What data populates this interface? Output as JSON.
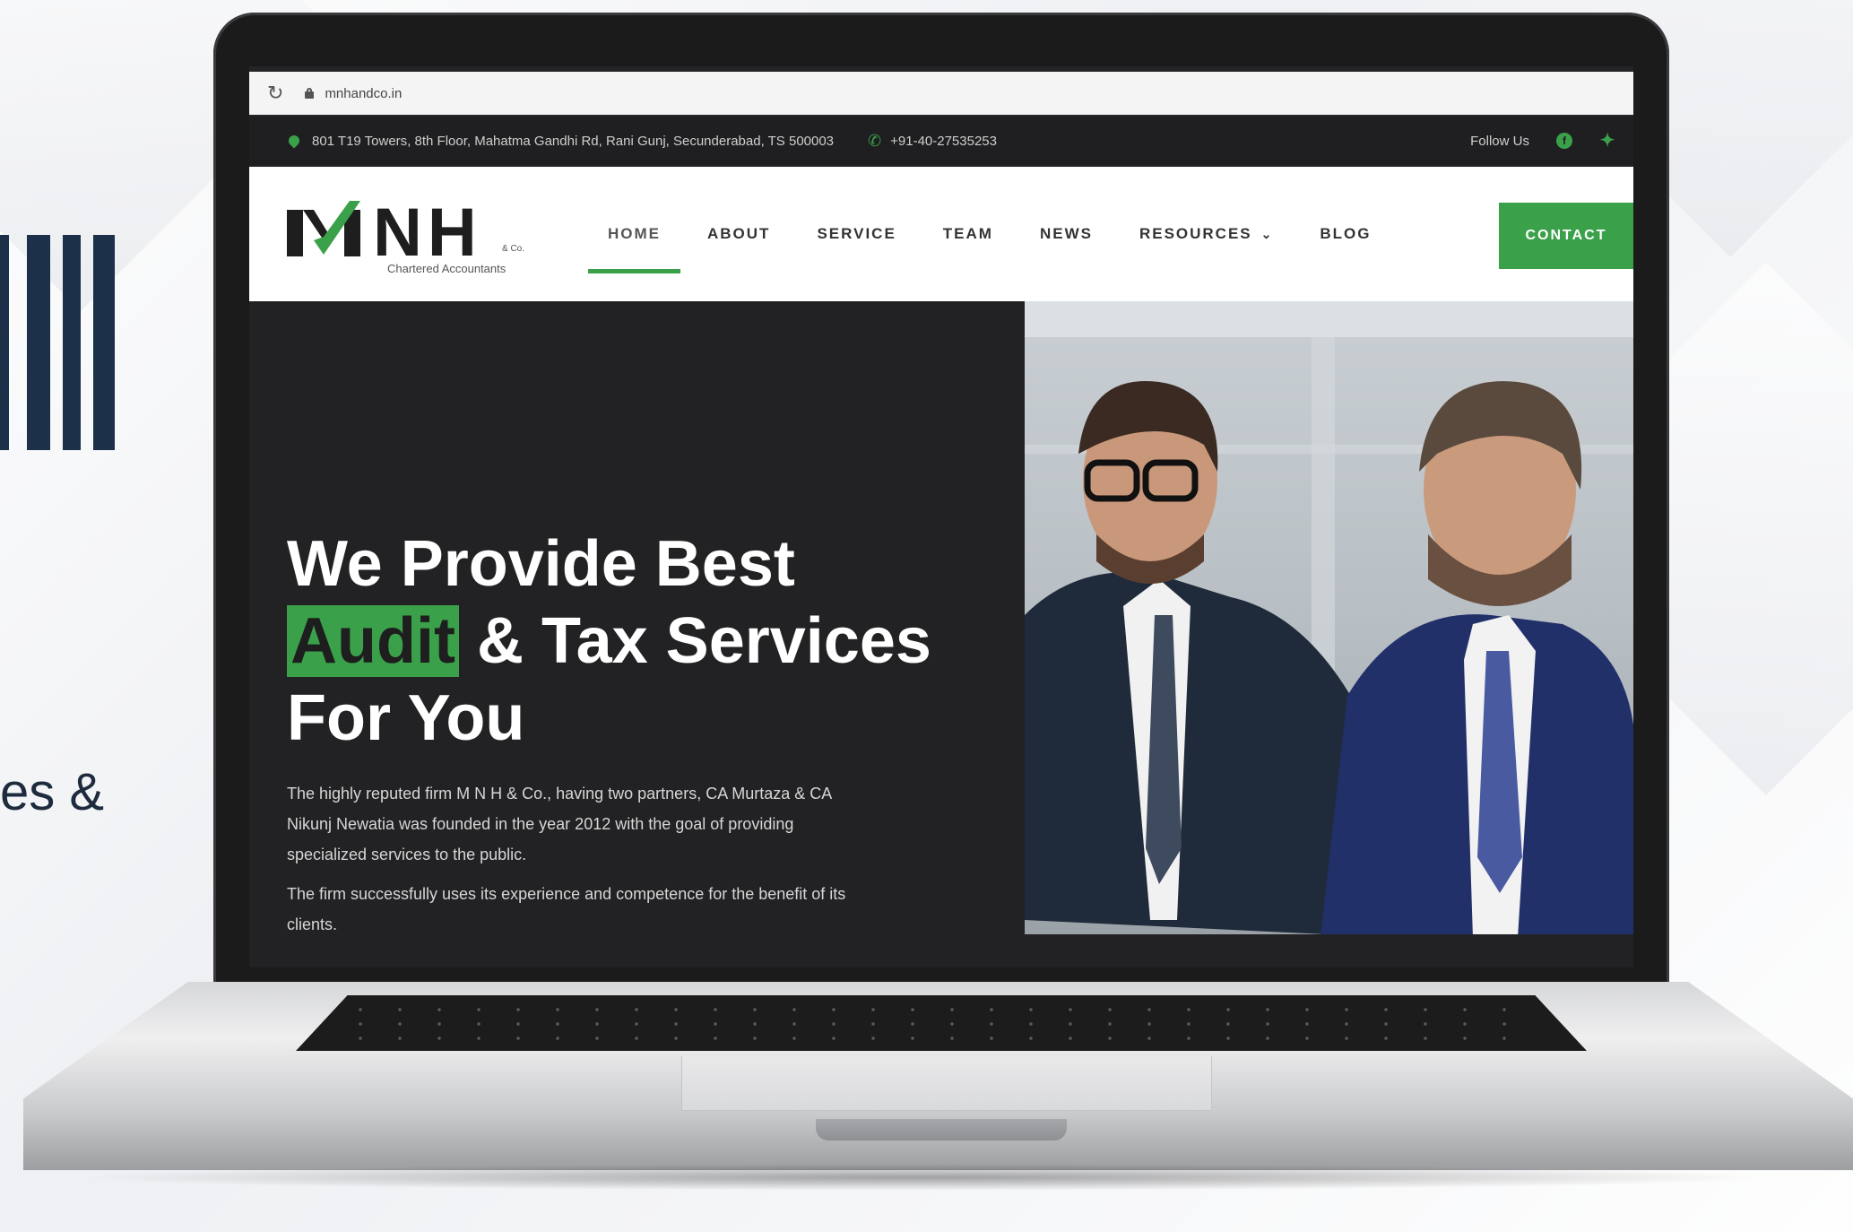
{
  "browser": {
    "url": "mnhandco.in"
  },
  "left_side": {
    "partial_text": "es &"
  },
  "topbar": {
    "address": "801 T19 Towers, 8th Floor, Mahatma Gandhi Rd, Rani Gunj, Secunderabad, TS 500003",
    "phone": "+91-40-27535253",
    "follow_label": "Follow Us"
  },
  "logo": {
    "letters": "NH",
    "suffix": "& Co.",
    "tagline": "Chartered Accountants"
  },
  "nav": {
    "items": [
      {
        "label": "HOME",
        "active": true
      },
      {
        "label": "ABOUT",
        "active": false
      },
      {
        "label": "SERVICE",
        "active": false
      },
      {
        "label": "TEAM",
        "active": false
      },
      {
        "label": "NEWS",
        "active": false
      },
      {
        "label": "RESOURCES",
        "active": false,
        "dropdown": true
      },
      {
        "label": "BLOG",
        "active": false
      }
    ],
    "contact_label": "CONTACT"
  },
  "hero": {
    "line1": "We Provide Best",
    "highlight": "Audit",
    "line2_rest": " & Tax Services",
    "line3": "For You",
    "paragraph1": "The highly reputed firm M N H & Co., having two partners, CA Murtaza & CA Nikunj Newatia was founded in the year 2012 with the goal of providing specialized services to the public.",
    "paragraph2": "The firm successfully uses its experience and competence for the benefit of its clients."
  },
  "colors": {
    "brand_green": "#3aa14a",
    "dark": "#222224",
    "navy": "#1d3049"
  }
}
